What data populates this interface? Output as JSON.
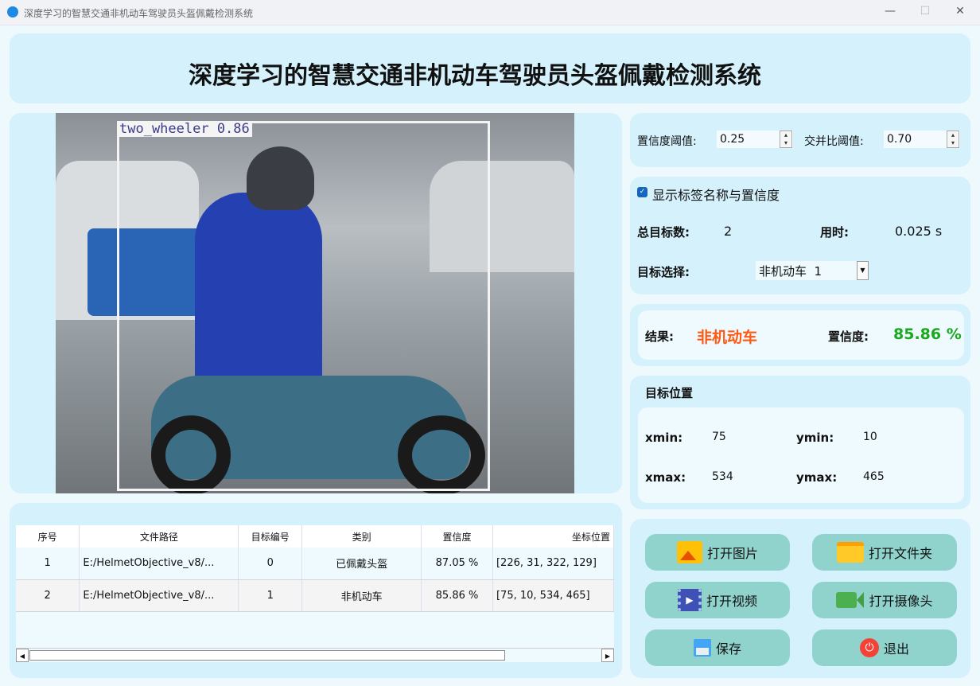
{
  "window": {
    "title": "深度学习的智慧交通非机动车驾驶员头盔佩戴检测系统",
    "minimize": "—",
    "maximize": "☐",
    "close": "✕"
  },
  "header": {
    "title": "深度学习的智慧交通非机动车驾驶员头盔佩戴检测系统"
  },
  "image": {
    "detection_label": "two_wheeler 0.86"
  },
  "params": {
    "conf_label": "置信度阈值:",
    "conf_value": "0.25",
    "iou_label": "交并比阈值:",
    "iou_value": "0.70"
  },
  "stats": {
    "show_label": "显示标签名称与置信度",
    "show_checked": true,
    "total_label": "总目标数:",
    "total_value": "2",
    "time_label": "用时:",
    "time_value": "0.025 s",
    "select_label": "目标选择:",
    "select_value": "非机动车  1"
  },
  "result": {
    "result_label": "结果:",
    "result_value": "非机动车",
    "conf_label": "置信度:",
    "conf_value": "85.86 %",
    "colors": {
      "result": "#ff5a14",
      "conf": "#19a81e"
    }
  },
  "position": {
    "title": "目标位置",
    "xmin_label": "xmin:",
    "xmin": "75",
    "ymin_label": "ymin:",
    "ymin": "10",
    "xmax_label": "xmax:",
    "xmax": "534",
    "ymax_label": "ymax:",
    "ymax": "465"
  },
  "table": {
    "headers": [
      "序号",
      "文件路径",
      "目标编号",
      "类别",
      "置信度",
      "坐标位置"
    ],
    "rows": [
      [
        "1",
        "E:/HelmetObjective_v8/...",
        "0",
        "已佩戴头盔",
        "87.05 %",
        "[226, 31, 322, 129]"
      ],
      [
        "2",
        "E:/HelmetObjective_v8/...",
        "1",
        "非机动车",
        "85.86 %",
        "[75, 10, 534, 465]"
      ]
    ]
  },
  "buttons": {
    "open_image": "打开图片",
    "open_folder": "打开文件夹",
    "open_video": "打开视频",
    "open_camera": "打开摄像头",
    "save": "保存",
    "exit": "退出"
  }
}
